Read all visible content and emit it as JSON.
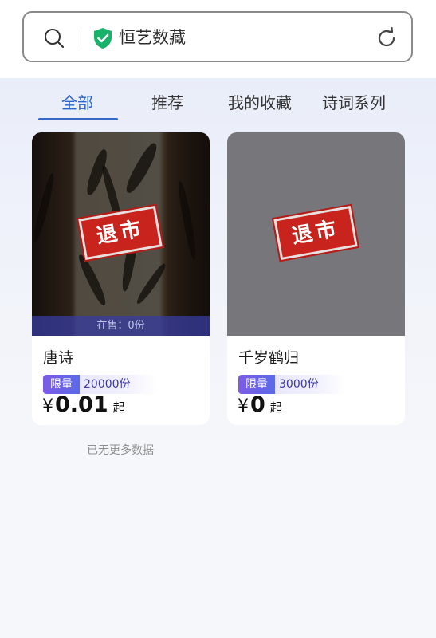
{
  "header": {
    "site_name": "恒艺数藏",
    "icons": [
      "search-icon",
      "verified-shield-icon",
      "refresh-icon"
    ],
    "shield_color": "#19b26b"
  },
  "tabs": [
    {
      "label": "全部",
      "active": true
    },
    {
      "label": "推荐",
      "active": false
    },
    {
      "label": "我的收藏",
      "active": false
    },
    {
      "label": "诗词系列",
      "active": false
    }
  ],
  "accent_color": "#2a63c9",
  "cards": [
    {
      "title": "唐诗",
      "stamp": "退市",
      "on_sale": "在售：0份",
      "limit_tag": "限量",
      "limit_count": "20000份",
      "price_symbol": "¥",
      "price": "0.01",
      "price_suffix": "起"
    },
    {
      "title": "千岁鹤归",
      "stamp": "退市",
      "limit_tag": "限量",
      "limit_count": "3000份",
      "price_symbol": "¥",
      "price": "0",
      "price_suffix": "起"
    }
  ],
  "footer": {
    "no_more": "已无更多数据"
  }
}
